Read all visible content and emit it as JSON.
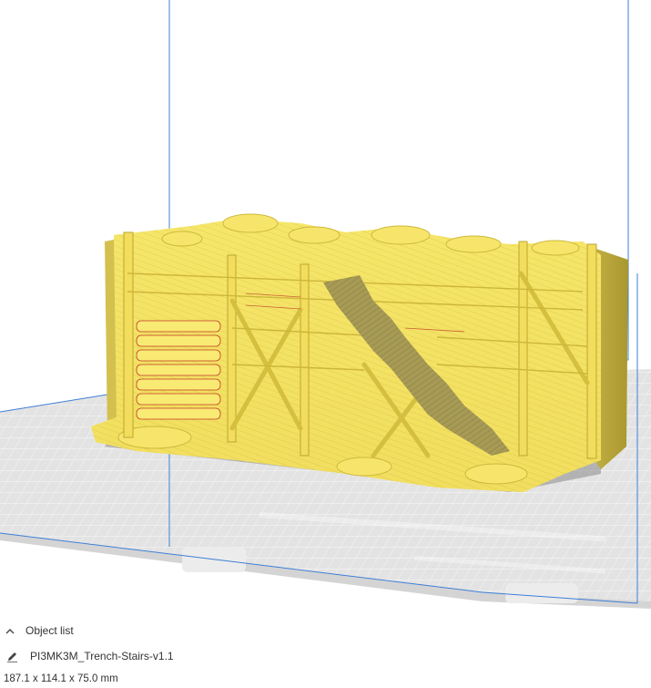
{
  "object_list": {
    "header_label": "Object list",
    "object_name": "PI3MK3M_Trench-Stairs-v1.1",
    "dimensions": "187.1 x 114.1 x 75.0 mm"
  },
  "icons": {
    "collapse": "chevron-up-icon",
    "edit": "pencil-icon"
  },
  "colors": {
    "model": "#f5e66a",
    "model_shadow": "#b9a93a",
    "build_plate": "#e4e4e4",
    "grid_line": "#ffffff",
    "volume_edge": "#3d7fd8",
    "text": "#333333"
  }
}
